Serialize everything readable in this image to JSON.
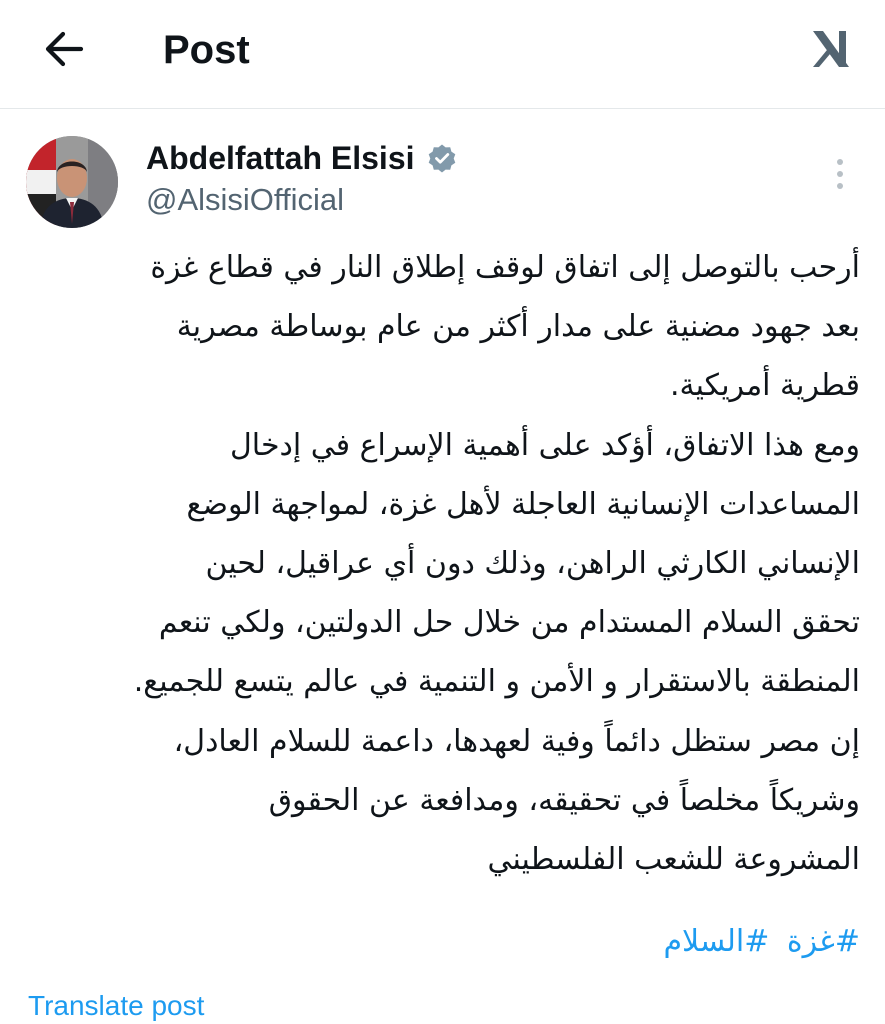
{
  "header": {
    "title": "Post",
    "back_icon": "arrow-left-icon",
    "logo_icon": "x-logo-icon"
  },
  "author": {
    "name": "Abdelfattah Elsisi",
    "handle": "@AlsisiOfficial",
    "verified_icon": "verified-badge-icon",
    "verified_color": "#829aab",
    "more_icon": "vertical-ellipsis-icon"
  },
  "tweet": {
    "lines": [
      "أرحب بالتوصل إلى اتفاق لوقف إطلاق النار في قطاع غزة",
      "بعد جهود مضنية على مدار أكثر من عام بوساطة مصرية",
      "قطرية أمريكية.",
      "ومع هذا الاتفاق، أؤكد على أهمية الإسراع في إدخال",
      "المساعدات الإنسانية العاجلة لأهل غزة، لمواجهة الوضع",
      "الإنساني الكارثي الراهن، وذلك دون أي عراقيل، لحين",
      "تحقق السلام المستدام من خلال حل الدولتين، ولكي تنعم",
      "المنطقة بالاستقرار و الأمن و التنمية في عالم يتسع للجميع.",
      "إن مصر ستظل دائماً وفية لعهدها، داعمة للسلام العادل،",
      "وشريكاً مخلصاً في تحقيقه، ومدافعة عن الحقوق",
      "المشروعة للشعب الفلسطيني"
    ],
    "hashtags": [
      "#غزة",
      "#السلام"
    ],
    "translate_label": "Translate post"
  },
  "colors": {
    "text": "#0f1419",
    "secondary": "#536471",
    "link": "#1d9bf0",
    "divider": "#e4e8ea"
  }
}
